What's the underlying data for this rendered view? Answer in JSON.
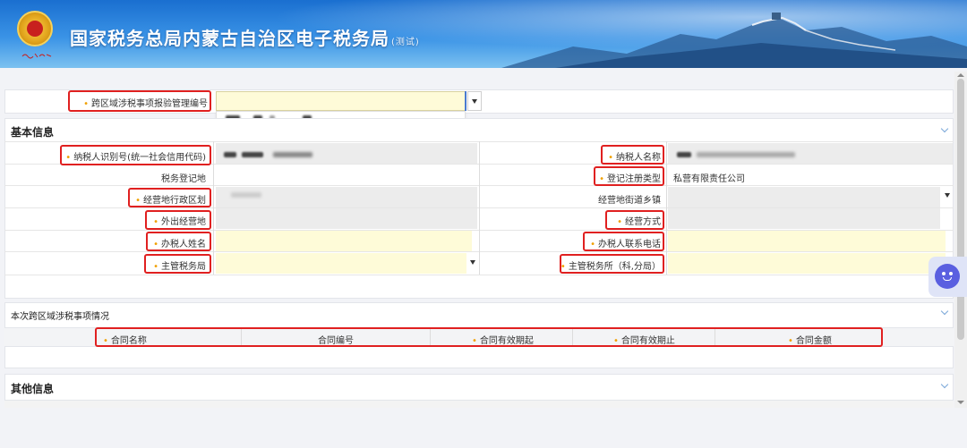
{
  "header": {
    "title": "国家税务总局内蒙古自治区电子税务局",
    "subtitle": "(测试)"
  },
  "top_field": {
    "label": "跨区域涉税事项报验管理编号",
    "value": ""
  },
  "basic_section": {
    "title": "基本信息",
    "rows": [
      {
        "left_label": "纳税人识别号(统一社会信用代码)",
        "left_required": true,
        "right_label": "纳税人名称",
        "right_required": true,
        "right_value": ""
      },
      {
        "left_label": "税务登记地",
        "left_required": false,
        "right_label": "登记注册类型",
        "right_required": true,
        "right_value": "私营有限责任公司"
      },
      {
        "left_label": "经营地行政区划",
        "left_required": true,
        "right_label": "经营地街道乡镇",
        "right_required": false,
        "right_value": ""
      },
      {
        "left_label": "外出经营地",
        "left_required": true,
        "right_label": "经营方式",
        "right_required": true,
        "right_value": ""
      },
      {
        "left_label": "办税人姓名",
        "left_required": true,
        "right_label": "办税人联系电话",
        "right_required": true,
        "right_value": ""
      },
      {
        "left_label": "主管税务局",
        "left_required": true,
        "right_label": "主管税务所（科,分局）",
        "right_required": true,
        "right_value": ""
      }
    ]
  },
  "contract_section": {
    "title": "本次跨区域涉税事项情况",
    "columns": [
      {
        "label": "合同名称",
        "required": true
      },
      {
        "label": "合同编号",
        "required": false
      },
      {
        "label": "合同有效期起",
        "required": true
      },
      {
        "label": "合同有效期止",
        "required": true
      },
      {
        "label": "合同金额",
        "required": true
      }
    ]
  },
  "other_section": {
    "title": "其他信息"
  },
  "colors": {
    "required_marker": "#f0a000",
    "highlight_border": "#e02020",
    "editable_fill": "#fefbd8",
    "readonly_fill": "#ececec",
    "banner_blue": "#1a6fd0"
  },
  "icons": [
    "emblem-icon",
    "dropdown-arrow-icon",
    "chevron-down-icon",
    "assistant-robot-icon"
  ]
}
